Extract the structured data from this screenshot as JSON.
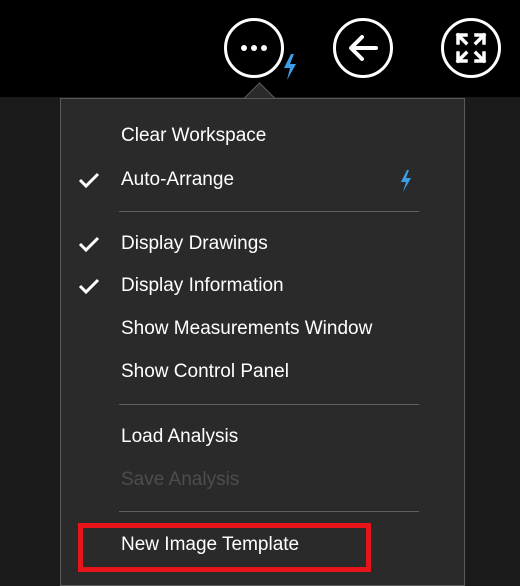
{
  "toolbar": {
    "more_icon": "more-options-icon",
    "back_icon": "back-arrow-icon",
    "fullscreen_icon": "fullscreen-icon",
    "bolt_icon": "lightning-bolt-icon"
  },
  "menu": {
    "items": [
      {
        "label": "Clear Workspace",
        "checked": false,
        "disabled": false
      },
      {
        "label": "Auto-Arrange",
        "checked": true,
        "disabled": false,
        "bolt": true
      },
      {
        "label": "Display Drawings",
        "checked": true,
        "disabled": false
      },
      {
        "label": "Display Information",
        "checked": true,
        "disabled": false
      },
      {
        "label": "Show Measurements Window",
        "checked": false,
        "disabled": false
      },
      {
        "label": "Show Control Panel",
        "checked": false,
        "disabled": false
      },
      {
        "label": "Load Analysis",
        "checked": false,
        "disabled": false
      },
      {
        "label": "Save Analysis",
        "checked": false,
        "disabled": true
      },
      {
        "label": "New Image Template",
        "checked": false,
        "disabled": false,
        "highlighted": true
      }
    ]
  },
  "colors": {
    "top_bar": "#000000",
    "workspace": "#1b1b1b",
    "menu_bg": "#2a2a2a",
    "menu_text": "#ffffff",
    "disabled_text": "#4d4d4d",
    "bolt": "#3a9ee8",
    "highlight": "#e8141c"
  }
}
